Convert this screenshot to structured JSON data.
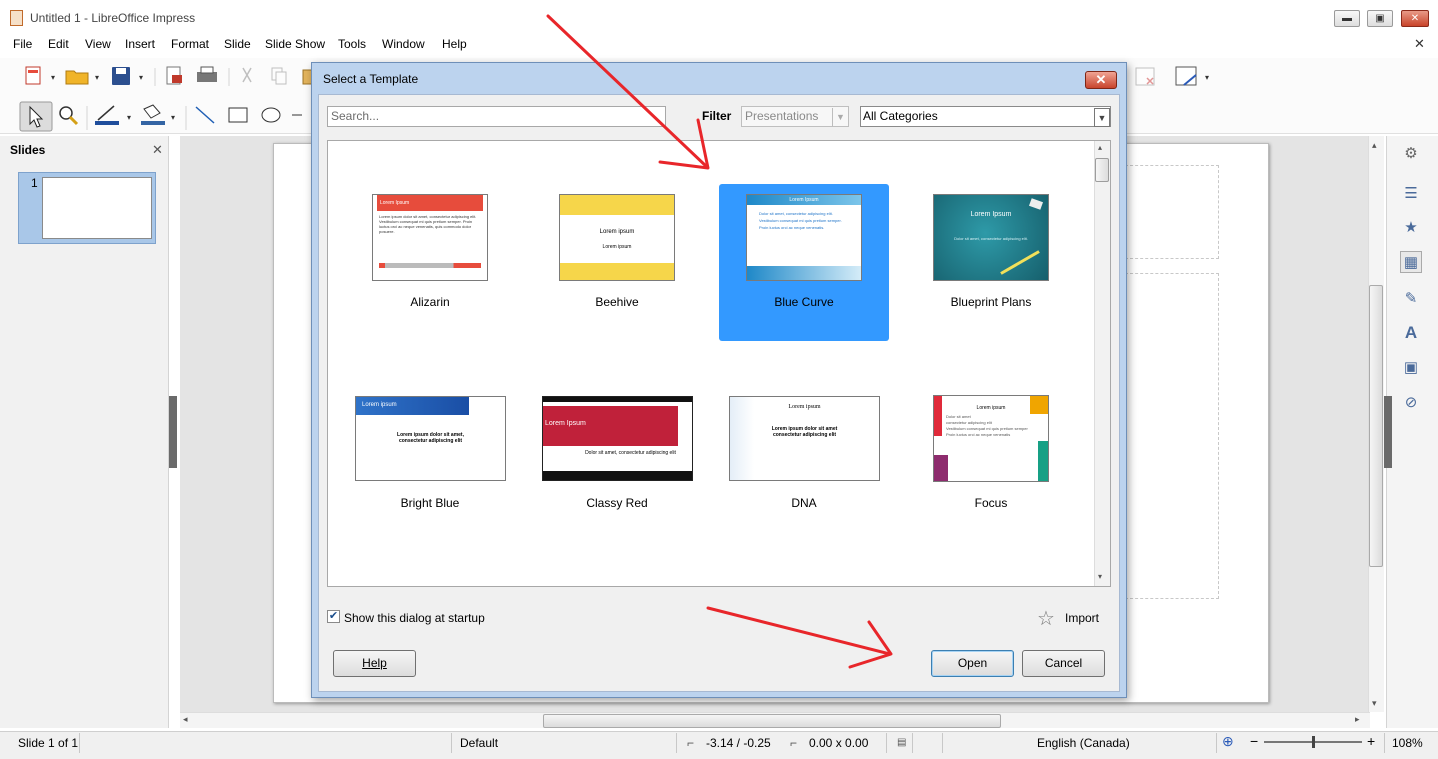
{
  "window": {
    "title": "Untitled 1 - LibreOffice Impress",
    "minimize": "▬",
    "restore": "▣",
    "close": "✕",
    "doc_close": "✕"
  },
  "menu": [
    "File",
    "Edit",
    "View",
    "Insert",
    "Format",
    "Slide",
    "Slide Show",
    "Tools",
    "Window",
    "Help"
  ],
  "slides_panel": {
    "title": "Slides",
    "close": "✕",
    "slide_number": "1"
  },
  "dialog": {
    "title": "Select a Template",
    "search_placeholder": "Search...",
    "filter_label": "Filter",
    "filter_value": "Presentations",
    "category_value": "All Categories",
    "templates": [
      {
        "name": "Alizarin",
        "selected": false,
        "heading": "Lorem Ipsum",
        "body": "Lorem ipsum dolor sit amet, consectetur adipiscing elit. Vestibulum consequat mi quis pretium semper. Proin luctus orci ac neque venenatis, quis commodo dolor posuere."
      },
      {
        "name": "Beehive",
        "selected": false,
        "heading": "Lorem ipsum",
        "body": "Lorem ipsum"
      },
      {
        "name": "Blue Curve",
        "selected": true,
        "heading": "Lorem Ipsum",
        "bullets": [
          "Dolor sit amet, consectetur adipiscing elit.",
          "Vestibulum consequat mi quis pretium semper.",
          "Proin luctus orci ac neque venenatis."
        ]
      },
      {
        "name": "Blueprint Plans",
        "selected": false,
        "heading": "Lorem Ipsum",
        "body": "Dolor sit amet, consectetur adipiscing elit."
      },
      {
        "name": "Bright Blue",
        "selected": false,
        "heading": "Lorem ipsum",
        "body": "Lorem ipsum dolor sit amet, consectetur adipiscing elit"
      },
      {
        "name": "Classy Red",
        "selected": false,
        "heading": "Lorem Ipsum",
        "body": "Dolor sit amet, consectetur adipiscing elit"
      },
      {
        "name": "DNA",
        "selected": false,
        "heading": "Lorem ipsum",
        "body": "Lorem ipsum dolor sit amet consectetur adipiscing elit"
      },
      {
        "name": "Focus",
        "selected": false,
        "heading": "Lorem ipsum",
        "bullets": [
          "Dolor sit amet",
          "consectetur adipiscing elit",
          "Vestibulum consequat mi quis pretium semper",
          "Proin luctus orci ac neque venenatis"
        ]
      }
    ],
    "show_at_startup_label": "Show this dialog at startup",
    "show_at_startup_checked": true,
    "import_label": "Import",
    "help_label": "Help",
    "open_label": "Open",
    "cancel_label": "Cancel"
  },
  "status": {
    "slide": "Slide 1 of 1",
    "layout": "Default",
    "position": "-3.14 / -0.25",
    "size": "0.00 x 0.00",
    "language": "English (Canada)",
    "zoom": "108%",
    "zoom_minus": "−",
    "zoom_plus": "+"
  },
  "colors": {
    "dialog_frame": "#bcd3ee",
    "selection": "#3399ff",
    "annotation_arrow": "#e8262a"
  }
}
